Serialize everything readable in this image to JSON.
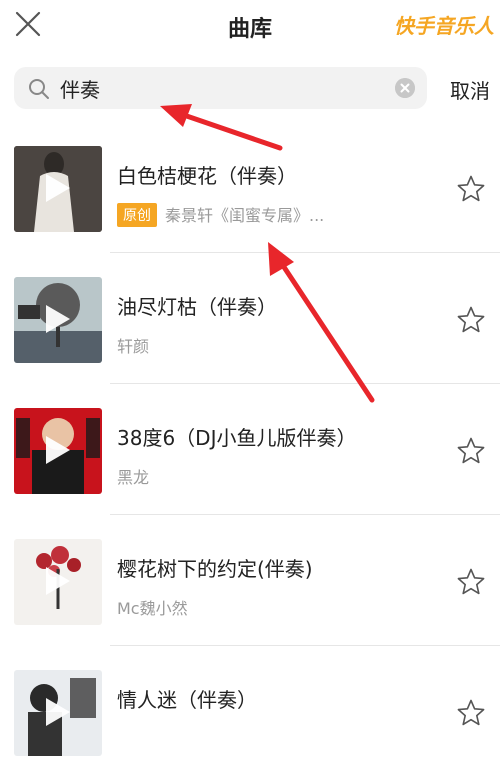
{
  "header": {
    "title": "曲库",
    "brand": "快手音乐人"
  },
  "search": {
    "value": "伴奏",
    "cancel_label": "取消"
  },
  "songs": [
    {
      "title": "白色桔梗花（伴奏）",
      "badge": "原创",
      "artist": "秦景轩《闺蜜专属》..."
    },
    {
      "title": "油尽灯枯（伴奏）",
      "badge": "",
      "artist": "轩颜"
    },
    {
      "title": "38度6（DJ小鱼儿版伴奏）",
      "badge": "",
      "artist": "黑龙"
    },
    {
      "title": "樱花树下的约定(伴奏)",
      "badge": "",
      "artist": "Mc魏小然"
    },
    {
      "title": "情人迷（伴奏）",
      "badge": "",
      "artist": ""
    }
  ],
  "colors": {
    "brand": "#f5a623",
    "arrow": "#e8262b",
    "divider": "#e6e6e6"
  }
}
